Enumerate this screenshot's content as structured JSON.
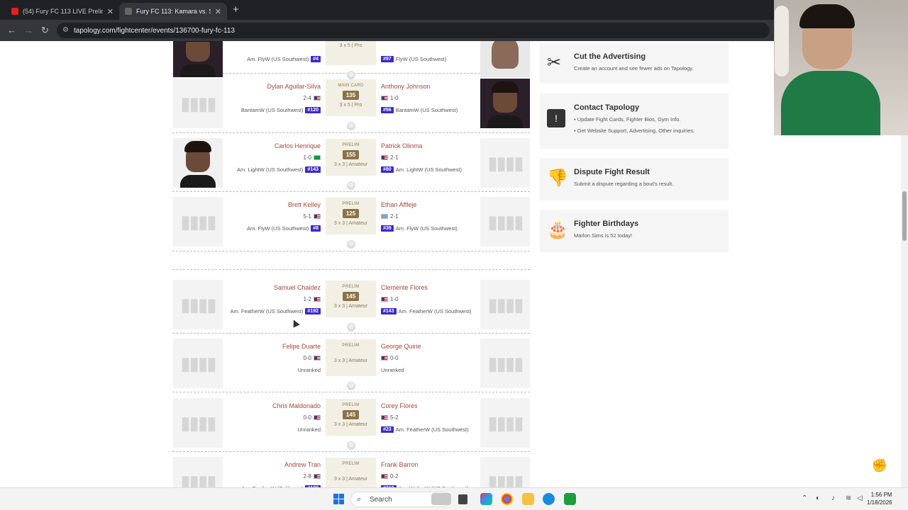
{
  "browser": {
    "tabs": [
      {
        "title": "(54) Fury FC 113 LIVE Prelims | ...",
        "favicon_color": "#e62117"
      },
      {
        "title": "Fury FC 113: Kamara vs. Silva | T...",
        "favicon_color": "#444444"
      }
    ],
    "url": "tapology.com/fightcenter/events/136700-fury-fc-113"
  },
  "fights": [
    {
      "left": {
        "name": "",
        "record": "",
        "flag": "",
        "weight_class": "Am. FlyW (US Southwest)",
        "rank": "#4",
        "photo": "dark"
      },
      "center": {
        "label": "",
        "weight": "",
        "rounds": "3 x 5 | Pro"
      },
      "right": {
        "name": "",
        "record": "",
        "flag": "",
        "weight_class": "FlyW (US Southwest)",
        "rank": "#97",
        "photo": "light"
      }
    },
    {
      "left": {
        "name": "Dylan Aguilar-Silva",
        "record": "2-4",
        "flag": "us",
        "weight_class": "BantamW (US Southwest)",
        "rank": "#120",
        "photo": "none"
      },
      "center": {
        "label": "MAIN CARD",
        "weight": "135",
        "rounds": "3 x 5 | Pro"
      },
      "right": {
        "name": "Anthony Johnson",
        "record": "1-0",
        "flag": "us",
        "weight_class": "BantamW (US Southwest)",
        "rank": "#56",
        "photo": "dark"
      }
    },
    {
      "left": {
        "name": "Carlos Henrique",
        "record": "1-0",
        "flag": "br",
        "weight_class": "Am. LightW (US Southwest)",
        "rank": "#143",
        "photo": "face"
      },
      "center": {
        "label": "PRELIM",
        "weight": "155",
        "rounds": "3 x 3 | Amateur"
      },
      "right": {
        "name": "Patrick Olinma",
        "record": "2-1",
        "flag": "us",
        "weight_class": "Am. LightW (US Southwest)",
        "rank": "#80",
        "photo": "none"
      }
    },
    {
      "left": {
        "name": "Brett Kelley",
        "record": "5-1",
        "flag": "us",
        "weight_class": "Am. FlyW (US Southwest)",
        "rank": "#8",
        "photo": "none"
      },
      "center": {
        "label": "PRELIM",
        "weight": "125",
        "rounds": "3 x 3 | Amateur"
      },
      "right": {
        "name": "Ethan Affleje",
        "record": "2-1",
        "flag": "gr",
        "weight_class": "Am. FlyW (US Southwest)",
        "rank": "#39",
        "photo": "none"
      }
    },
    {
      "left": {
        "name": "Samuel Chaidez",
        "record": "1-2",
        "flag": "us",
        "weight_class": "Am. FeatherW (US Southwest)",
        "rank": "#192",
        "photo": "none"
      },
      "center": {
        "label": "PRELIM",
        "weight": "145",
        "rounds": "3 x 3 | Amateur"
      },
      "right": {
        "name": "Clemente Flores",
        "record": "1-0",
        "flag": "us",
        "weight_class": "Am. FeatherW (US Southwest)",
        "rank": "#143",
        "photo": "none"
      }
    },
    {
      "left": {
        "name": "Felipe Duarte",
        "record": "0-0",
        "flag": "us",
        "weight_class": "Unranked",
        "rank": "",
        "photo": "none"
      },
      "center": {
        "label": "PRELIM",
        "weight": "",
        "rounds": "3 x 3 | Amateur"
      },
      "right": {
        "name": "George Quirie",
        "record": "0-0",
        "flag": "us",
        "weight_class": "Unranked",
        "rank": "",
        "photo": "none"
      }
    },
    {
      "left": {
        "name": "Chris Maldonado",
        "record": "0-0",
        "flag": "us",
        "weight_class": "Unranked",
        "rank": "",
        "photo": "none"
      },
      "center": {
        "label": "PRELIM",
        "weight": "145",
        "rounds": "3 x 3 | Amateur"
      },
      "right": {
        "name": "Corey Flores",
        "record": "5-2",
        "flag": "us",
        "weight_class": "Am. FeatherW (US Southwest)",
        "rank": "#23",
        "photo": "none"
      }
    },
    {
      "left": {
        "name": "Andrew Tran",
        "record": "2-8",
        "flag": "us",
        "weight_class": "Am. FeatherW (California)",
        "rank": "#109",
        "photo": "none"
      },
      "center": {
        "label": "PRELIM",
        "weight": "",
        "rounds": "3 x 3 | Amateur"
      },
      "right": {
        "name": "Frank Barron",
        "record": "0-2",
        "flag": "us",
        "weight_class": "Am. WelterW (US Southwest)",
        "rank": "#210",
        "photo": "none"
      }
    }
  ],
  "sidebar": {
    "panels": [
      {
        "icon": "scissors-icon",
        "glyph": "✂",
        "title": "Cut the Advertising",
        "lines": [
          "Create an account and see fewer ads on Tapology."
        ]
      },
      {
        "icon": "exclamation-icon",
        "glyph": "!",
        "title": "Contact Tapology",
        "lines": [
          "• Update Fight Cards, Fighter Bios, Gym Info.",
          "• Get Website Support, Advertising, Other inquiries."
        ]
      },
      {
        "icon": "thumbs-down-icon",
        "glyph": "👎",
        "title": "Dispute Fight Result",
        "lines": [
          "Submit a dispute regarding a bout's result."
        ]
      },
      {
        "icon": "cake-icon",
        "glyph": "🎂",
        "title": "Fighter Birthdays",
        "lines": [
          "Marlon Sims is 52 today!"
        ]
      }
    ]
  },
  "taskbar": {
    "search_placeholder": "Search",
    "time": "1:56 PM",
    "date": "1/18/2026"
  }
}
